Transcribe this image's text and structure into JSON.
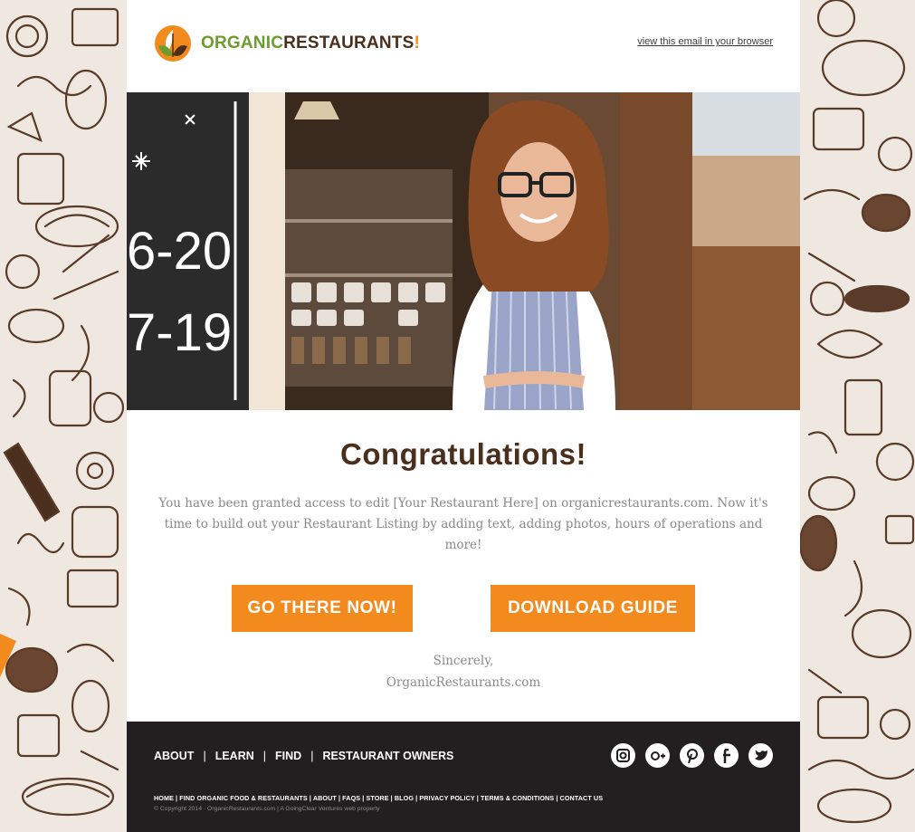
{
  "brand": {
    "logo_part1": "ORGANIC",
    "logo_part2": "RESTAURANTS",
    "logo_part3": "!",
    "colors": {
      "green": "#6d9c2e",
      "brown": "#4a2f1c",
      "orange": "#f28a1e",
      "footer": "#231f20"
    }
  },
  "header": {
    "view_link": "view this email in your browser"
  },
  "hero": {
    "chalkboard_line1": "6-20",
    "chalkboard_line2": "7-19"
  },
  "main": {
    "title": "Congratulations!",
    "body": "You have been granted access to edit [Your Restaurant Here] on organicrestaurants.com.   Now it's time to build out your Restaurant Listing by adding text, adding photos, hours of operations and more!",
    "button_primary": "GO THERE NOW!",
    "button_secondary": "DOWNLOAD GUIDE",
    "signoff": "Sincerely,",
    "signature": "OrganicRestaurants.com"
  },
  "footer": {
    "nav": [
      "ABOUT",
      "LEARN",
      "FIND",
      "RESTAURANT OWNERS"
    ],
    "nav_separator": "|",
    "social_icons": [
      "instagram-icon",
      "google-plus-icon",
      "pinterest-icon",
      "facebook-icon",
      "twitter-icon"
    ],
    "links": "HOME | FIND ORGANIC FOOD & RESTAURANTS | ABOUT | FAQS | STORE | BLOG | PRIVACY POLICY | TERMS & CONDITIONS | CONTACT US",
    "copyright": "© Copyright 2014 · OrganicRestaurants.com | A GoingClear Ventures web property"
  }
}
